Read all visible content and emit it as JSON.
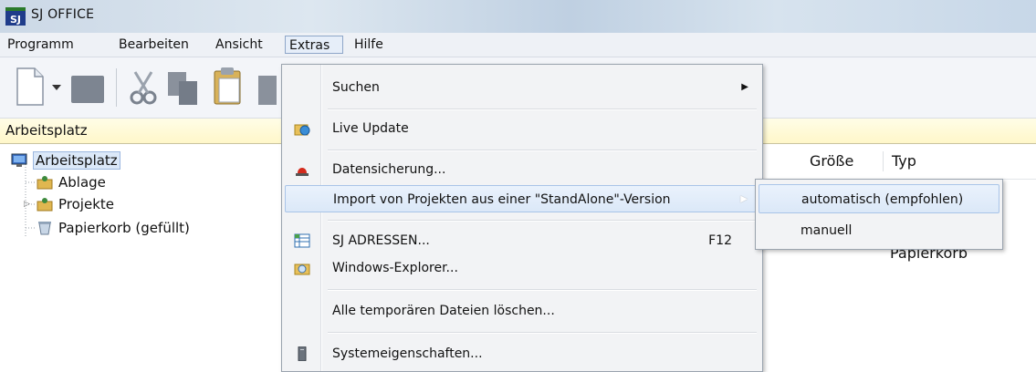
{
  "window": {
    "title": "SJ OFFICE",
    "app_icon_text": "SJ"
  },
  "menubar": {
    "items": [
      {
        "label": "Programm"
      },
      {
        "label": "Bearbeiten"
      },
      {
        "label": "Ansicht"
      },
      {
        "label": "Extras",
        "active": true
      },
      {
        "label": "Hilfe"
      }
    ]
  },
  "pathbar": {
    "path": "Arbeitsplatz"
  },
  "tree": {
    "items": [
      {
        "label": "Arbeitsplatz",
        "selected": true
      },
      {
        "label": "Ablage"
      },
      {
        "label": "Projekte"
      },
      {
        "label": "Papierkorb (gefüllt)"
      }
    ]
  },
  "list": {
    "columns": [
      "Größe",
      "Typ"
    ],
    "partial_text": "Papierkorb"
  },
  "extras_menu": {
    "items": [
      {
        "label": "Suchen",
        "has_submenu": true
      },
      {
        "label": "Live Update",
        "icon": "live-update-icon"
      },
      {
        "label": "Datensicherung...",
        "icon": "siren-icon"
      },
      {
        "label": "Import von Projekten aus einer \"StandAlone\"-Version",
        "has_submenu": true,
        "highlighted": true
      },
      {
        "label": "SJ ADRESSEN...",
        "shortcut": "F12",
        "icon": "address-book-icon"
      },
      {
        "label": "Windows-Explorer...",
        "icon": "explorer-icon"
      },
      {
        "label": "Alle temporären Dateien löschen..."
      },
      {
        "label": "Systemeigenschaften...",
        "icon": "system-properties-icon"
      }
    ]
  },
  "import_submenu": {
    "items": [
      {
        "label": "automatisch (empfohlen)",
        "highlighted": true
      },
      {
        "label": "manuell"
      }
    ]
  }
}
